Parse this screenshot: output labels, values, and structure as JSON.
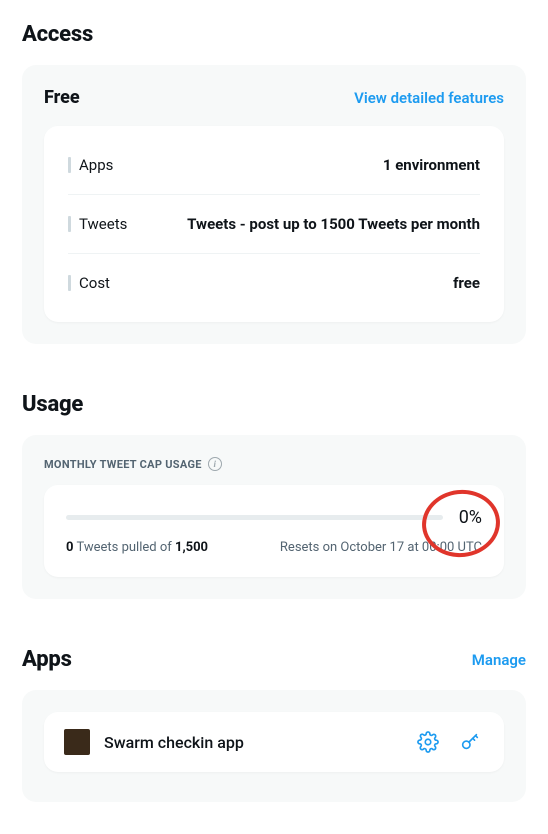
{
  "access": {
    "title": "Access",
    "plan_name": "Free",
    "detailed_link": "View detailed features",
    "rows": [
      {
        "label": "Apps",
        "value": "1 environment"
      },
      {
        "label": "Tweets",
        "value": "Tweets - post up to 1500 Tweets per month"
      },
      {
        "label": "Cost",
        "value": "free"
      }
    ]
  },
  "usage": {
    "title": "Usage",
    "cap_label": "MONTHLY TWEET CAP USAGE",
    "percent": "0%",
    "pulled_count": "0",
    "pulled_mid": " Tweets pulled of ",
    "pulled_limit": "1,500",
    "reset_text": "Resets on October 17 at 00:00 UTC"
  },
  "apps": {
    "title": "Apps",
    "manage_link": "Manage",
    "items": [
      {
        "name": "Swarm checkin app"
      }
    ]
  }
}
